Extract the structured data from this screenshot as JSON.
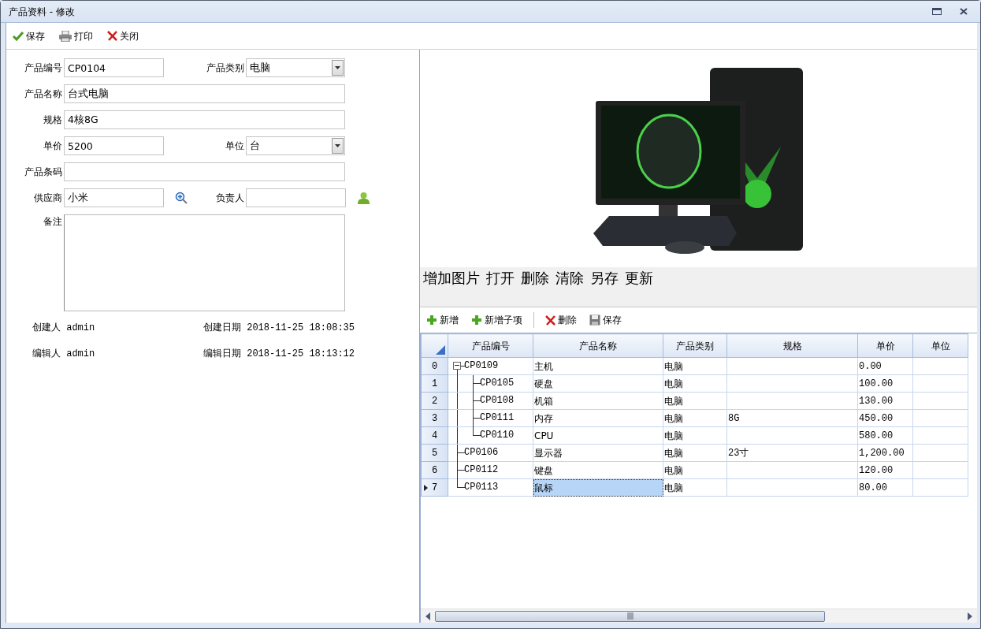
{
  "window": {
    "title": "产品资料 - 修改"
  },
  "toolbar": [
    {
      "label": "保存",
      "kind": "check"
    },
    {
      "label": "打印",
      "kind": "print"
    },
    {
      "label": "关闭",
      "kind": "close"
    }
  ],
  "form": {
    "rows": [
      [
        {
          "label": "产品编号",
          "kind": "text",
          "value": "CP0104"
        },
        {
          "label": "产品类别",
          "kind": "select",
          "value": "电脑"
        }
      ],
      [
        {
          "label": "产品名称",
          "kind": "text",
          "value": "台式电脑"
        }
      ],
      [
        {
          "label": "规格",
          "kind": "text",
          "value": "4核8G"
        }
      ],
      [
        {
          "label": "单价",
          "kind": "text",
          "value": "5200"
        },
        {
          "label": "单位",
          "kind": "select",
          "value": "台"
        }
      ],
      [
        {
          "label": "产品条码",
          "kind": "text"
        }
      ],
      [
        {
          "label": "供应商",
          "kind": "search",
          "value": "小米"
        },
        {
          "label": "负责人",
          "kind": "person"
        }
      ],
      [
        {
          "label": "备注",
          "kind": "textarea"
        }
      ]
    ],
    "audit": [
      [
        {
          "label": "创建人",
          "value": "admin"
        },
        {
          "label": "创建日期",
          "value": "2018-11-25 18:08:35"
        }
      ],
      [
        {
          "label": "编辑人",
          "value": "admin"
        },
        {
          "label": "编辑日期",
          "value": "2018-11-25 18:13:12"
        }
      ]
    ]
  },
  "image_actions": [
    "增加图片",
    "打开",
    "删除",
    "清除",
    "另存",
    "更新"
  ],
  "grid_toolbar": [
    {
      "label": "新增",
      "kind": "add"
    },
    {
      "label": "新增子项",
      "kind": "add"
    },
    {
      "kind": "separator"
    },
    {
      "label": "删除",
      "kind": "delete"
    },
    {
      "label": "保存",
      "kind": "save"
    }
  ],
  "grid": {
    "columns": [
      "产品编号",
      "产品名称",
      "产品类别",
      "规格",
      "单价",
      "单位"
    ],
    "rows": [
      {
        "row_number": "0",
        "code": "CP0109",
        "name": "主机",
        "category": "电脑",
        "price": "0.00",
        "selected": false,
        "expanded": true,
        "children": [
          {
            "row_number": "1",
            "code": "CP0105",
            "name": "硬盘",
            "category": "电脑",
            "price": "100.00",
            "selected": false
          },
          {
            "row_number": "2",
            "code": "CP0108",
            "name": "机箱",
            "category": "电脑",
            "price": "130.00",
            "selected": false
          },
          {
            "row_number": "3",
            "code": "CP0111",
            "name": "内存",
            "category": "电脑",
            "spec": "8G",
            "price": "450.00",
            "selected": false
          },
          {
            "row_number": "4",
            "code": "CP0110",
            "name": "CPU",
            "category": "电脑",
            "price": "580.00",
            "selected": false
          }
        ]
      },
      {
        "row_number": "5",
        "code": "CP0106",
        "name": "显示器",
        "category": "电脑",
        "spec": "23寸",
        "price": "1,200.00",
        "selected": false
      },
      {
        "row_number": "6",
        "code": "CP0112",
        "name": "键盘",
        "category": "电脑",
        "price": "120.00",
        "selected": false
      },
      {
        "row_number": "7",
        "code": "CP0113",
        "name": "鼠标",
        "category": "电脑",
        "price": "80.00",
        "selected": true
      }
    ]
  }
}
